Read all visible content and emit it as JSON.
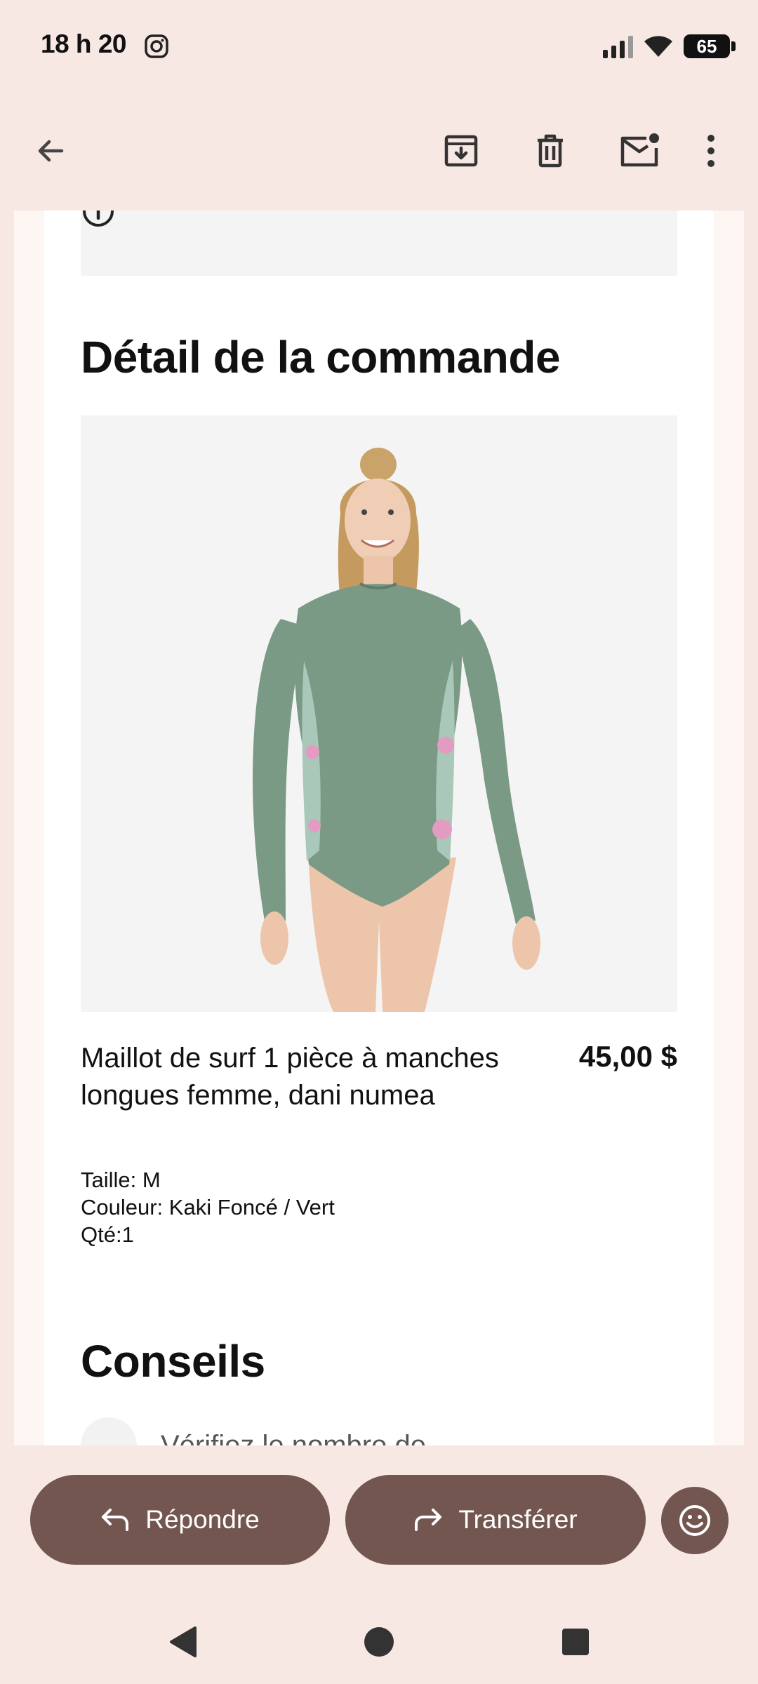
{
  "status_bar": {
    "time": "18 h 20",
    "battery": "65"
  },
  "app_bar": {
    "icons": [
      "back-arrow-icon",
      "archive-icon",
      "delete-icon",
      "mark-unread-icon",
      "more-vert-icon"
    ]
  },
  "email": {
    "order_title": "Détail de la commande",
    "product": {
      "name": "Maillot de surf 1 pièce à manches longues femme, dani numea",
      "price": "45,00 $",
      "size": "Taille: M",
      "color": "Couleur: Kaki Foncé / Vert",
      "qty": "Qté:1"
    },
    "tips_title": "Conseils",
    "tip_text": "Vérifiez le nombre de"
  },
  "actions": {
    "reply_label": "Répondre",
    "forward_label": "Transférer"
  },
  "colors": {
    "background": "#f8e8e4",
    "action_button": "#735650",
    "image_background": "#f4f4f4",
    "swimsuit": "#7a9a86"
  }
}
